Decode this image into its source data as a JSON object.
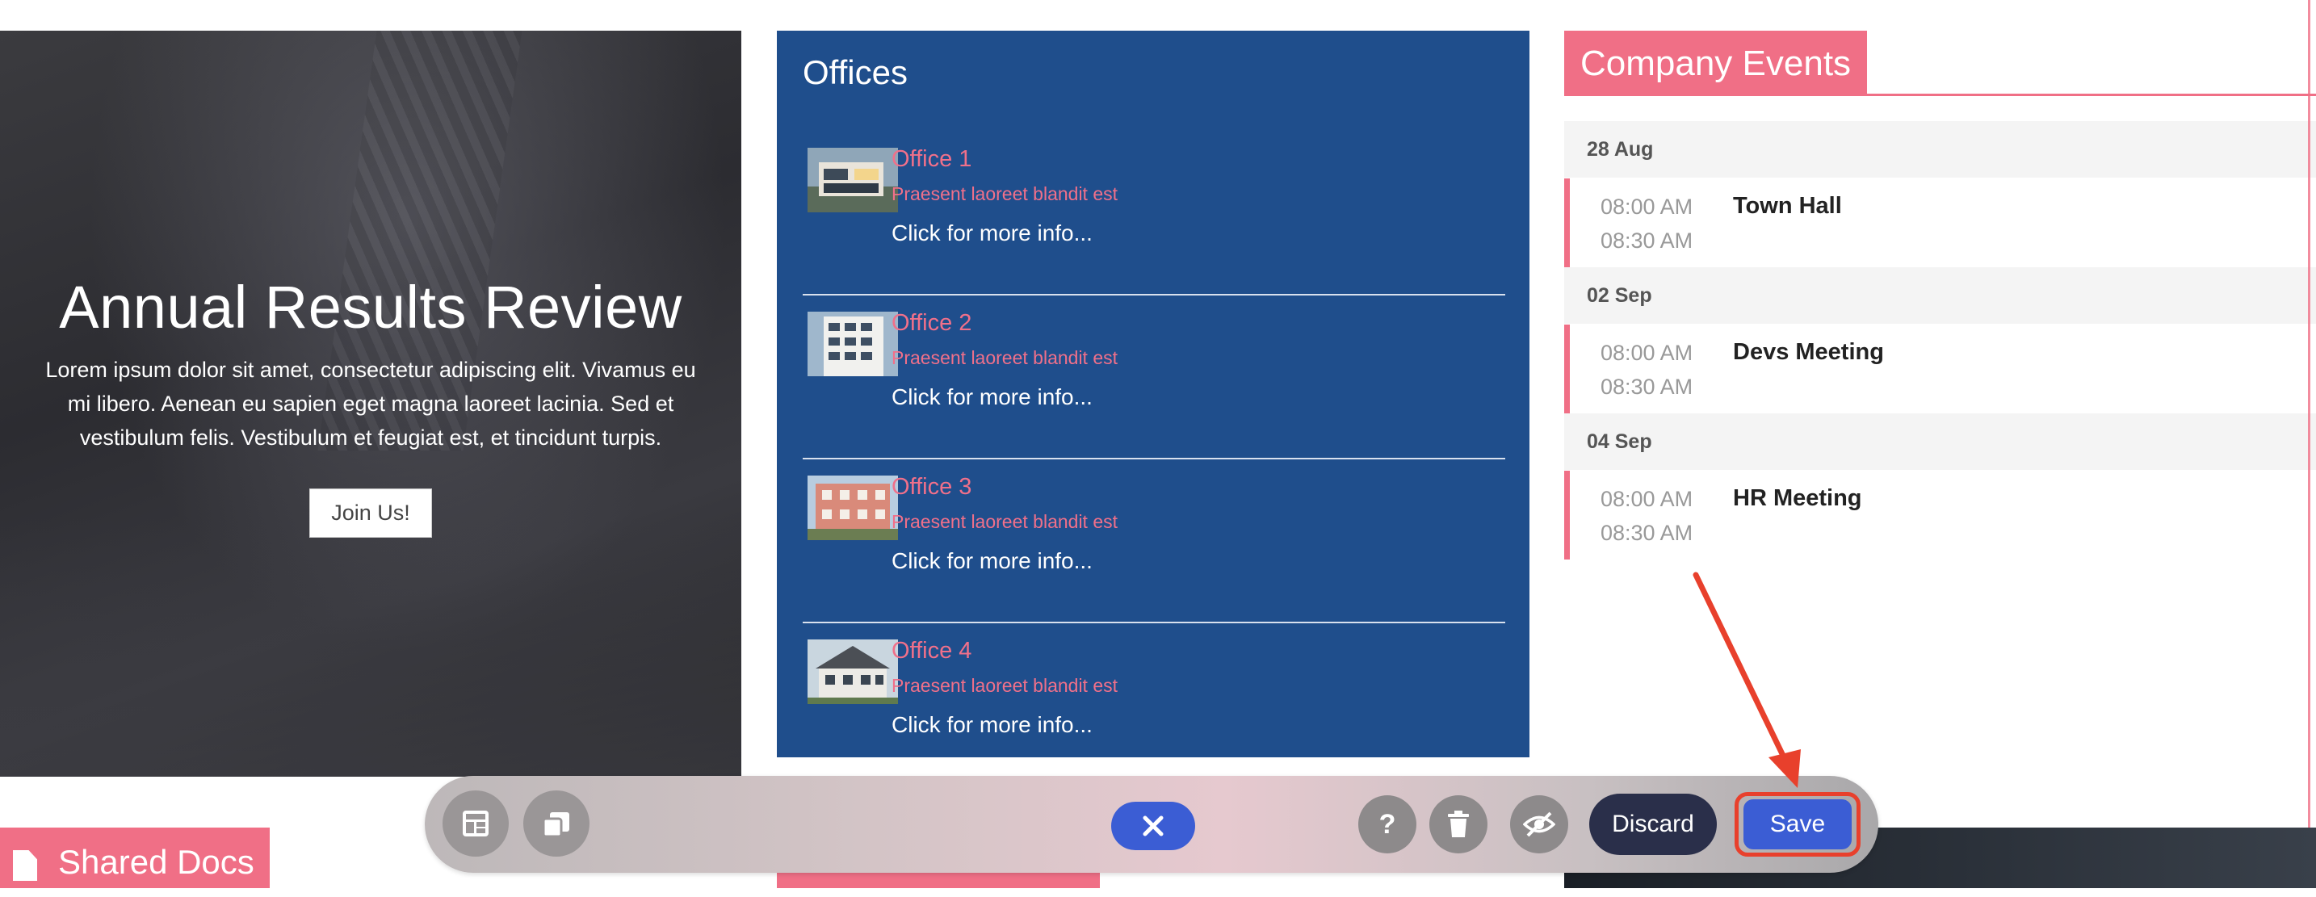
{
  "hero": {
    "title": "Annual Results Review",
    "text": "Lorem ipsum dolor sit amet, consectetur adipiscing elit. Vivamus eu mi libero. Aenean eu sapien eget magna laoreet lacinia. Sed et vestibulum felis. Vestibulum et feugiat est, et tincidunt turpis.",
    "button": "Join Us!"
  },
  "offices": {
    "title": "Offices",
    "items": [
      {
        "name": "Office 1",
        "desc": "Praesent laoreet blandit est",
        "more": "Click for more info..."
      },
      {
        "name": "Office 2",
        "desc": "Praesent laoreet blandit est",
        "more": "Click for more info..."
      },
      {
        "name": "Office 3",
        "desc": "Praesent laoreet blandit est",
        "more": "Click for more info..."
      },
      {
        "name": "Office 4",
        "desc": "Praesent laoreet blandit est",
        "more": "Click for more info..."
      }
    ]
  },
  "events": {
    "title": "Company Events",
    "days": [
      {
        "date": "28 Aug",
        "start": "08:00 AM",
        "end": "08:30 AM",
        "name": "Town Hall"
      },
      {
        "date": "02 Sep",
        "start": "08:00 AM",
        "end": "08:30 AM",
        "name": "Devs Meeting"
      },
      {
        "date": "04 Sep",
        "start": "08:00 AM",
        "end": "08:30 AM",
        "name": "HR Meeting"
      }
    ]
  },
  "sections": {
    "shared_docs": "Shared Docs"
  },
  "toolbar": {
    "discard_label": "Discard",
    "save_label": "Save",
    "help_label": "?"
  },
  "colors": {
    "accent": "#f06f86",
    "offices_bg": "#1f4e8c",
    "primary_button": "#3b5dd4",
    "discard_bg": "#2a2f4a",
    "highlight": "#e8402c"
  }
}
